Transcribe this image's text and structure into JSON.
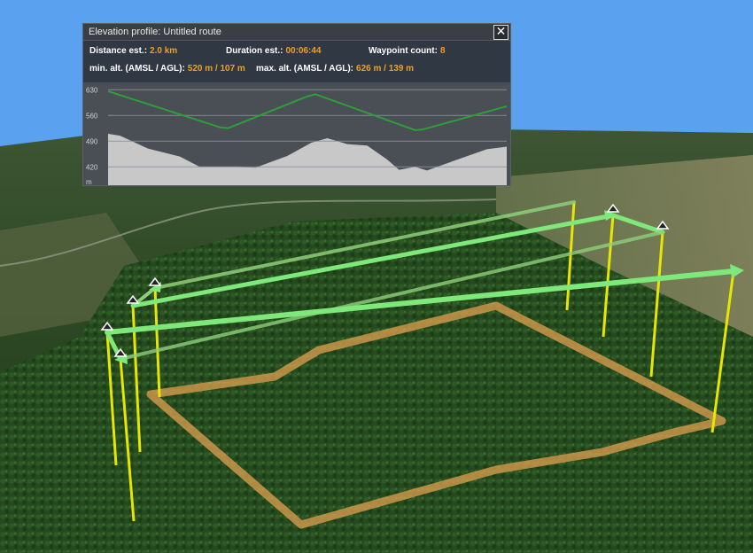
{
  "panel": {
    "title": "Elevation profile: Untitled route",
    "close_glyph": "✕",
    "stats": {
      "distance_label": "Distance est.:",
      "distance_value": "2.0 km",
      "duration_label": "Duration est.:",
      "duration_value": "00:06:44",
      "waypoint_label": "Waypoint count:",
      "waypoint_value": "8",
      "min_alt_label": "min. alt. (AMSL / AGL):",
      "min_alt_value": "520 m / 107 m",
      "max_alt_label": "max. alt. (AMSL / AGL):",
      "max_alt_value": "626 m / 139 m"
    },
    "accent_color": "#f0a020"
  },
  "chart_data": {
    "type": "area",
    "y_tick_labels": [
      "630",
      "560",
      "490",
      "420",
      "m"
    ],
    "y_ticks": [
      630,
      560,
      490,
      420
    ],
    "ylim": [
      370,
      650
    ],
    "xlim": [
      0,
      100
    ],
    "grid": true,
    "series": [
      {
        "kind": "line",
        "color": "#2f9e3a",
        "x": [
          0,
          28,
          30,
          50,
          52,
          77,
          79,
          100
        ],
        "y": [
          626,
          528,
          525,
          612,
          618,
          520,
          522,
          585
        ]
      },
      {
        "kind": "area",
        "color": "#c8c8c8",
        "x": [
          0,
          3,
          10,
          18,
          23,
          31,
          37,
          45,
          51,
          55,
          60,
          65,
          70,
          73,
          77,
          80,
          83,
          89,
          95,
          100
        ],
        "y": [
          510,
          505,
          470,
          448,
          420,
          420,
          418,
          450,
          486,
          498,
          482,
          478,
          440,
          412,
          420,
          410,
          422,
          445,
          468,
          475
        ]
      }
    ]
  },
  "scene": {
    "sky_color": "#5aa2f0",
    "path_color": "#7fe87a",
    "pole_color": "#e6e600",
    "boundary_color": "#e0a050"
  }
}
